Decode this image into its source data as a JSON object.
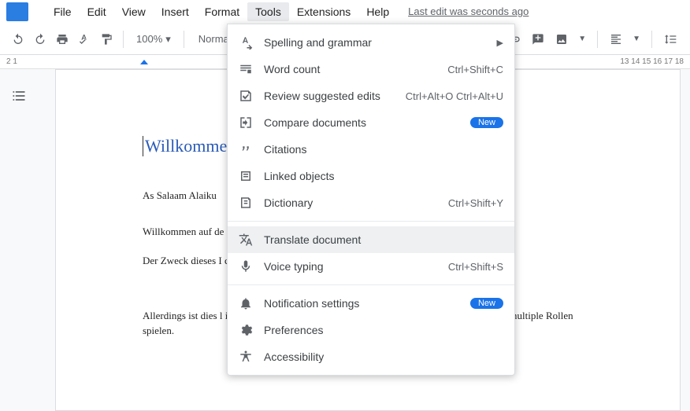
{
  "menubar": {
    "items": [
      "File",
      "Edit",
      "View",
      "Insert",
      "Format",
      "Tools",
      "Extensions",
      "Help"
    ],
    "active_index": 5,
    "last_edit_text": "Last edit was seconds ago"
  },
  "toolbar": {
    "zoom": "100%",
    "style": "Normal"
  },
  "ruler": {
    "left": "2    1",
    "right": "13    14    15    16    17    18"
  },
  "tools_menu": {
    "items": [
      {
        "icon": "spelling",
        "label": "Spelling and grammar",
        "shortcut": "",
        "arrow": true,
        "type": "item"
      },
      {
        "icon": "wordcount",
        "label": "Word count",
        "shortcut": "Ctrl+Shift+C",
        "type": "item"
      },
      {
        "icon": "review",
        "label": "Review suggested edits",
        "shortcut": "Ctrl+Alt+O Ctrl+Alt+U",
        "type": "item"
      },
      {
        "icon": "compare",
        "label": "Compare documents",
        "badge": "New",
        "type": "item"
      },
      {
        "icon": "citations",
        "label": "Citations",
        "type": "item"
      },
      {
        "icon": "linked",
        "label": "Linked objects",
        "type": "item"
      },
      {
        "icon": "dictionary",
        "label": "Dictionary",
        "shortcut": "Ctrl+Shift+Y",
        "type": "item"
      },
      {
        "type": "sep"
      },
      {
        "icon": "translate",
        "label": "Translate document",
        "type": "item",
        "hover": true
      },
      {
        "icon": "voice",
        "label": "Voice typing",
        "shortcut": "Ctrl+Shift+S",
        "type": "item"
      },
      {
        "type": "sep"
      },
      {
        "icon": "notification",
        "label": "Notification settings",
        "badge": "New",
        "type": "item"
      },
      {
        "icon": "preferences",
        "label": "Preferences",
        "type": "item"
      },
      {
        "icon": "accessibility",
        "label": "Accessibility",
        "type": "item"
      }
    ]
  },
  "document": {
    "title": "Willkommen",
    "paragraphs": [
      "As Salaam Alaiku",
      "Willkommen auf de                                                                                                                       eren Kauf. Ich hoffe, da                                                                                                                       eit zu erreichen.",
      "Der Zweck dieses I                                                                                                                     chreiben, und maximiert Verk",
      "Allerdings ist dies l                                                                                                                        irklich hart arbeiten. Du musst dein Denken aktualisieren und Juggle multiple Rollen spielen."
    ]
  }
}
